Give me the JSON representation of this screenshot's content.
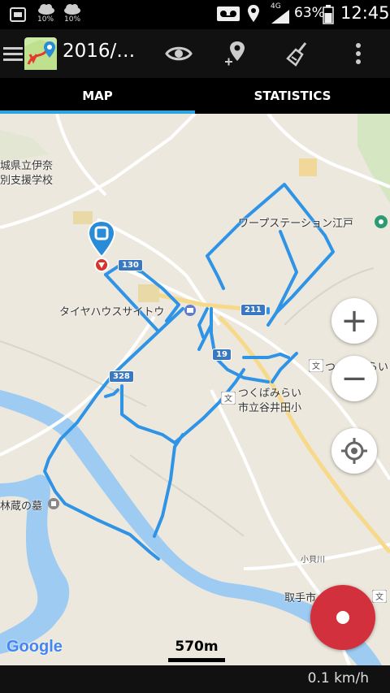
{
  "status_bar": {
    "weather_1_pct": "10%",
    "weather_2_pct": "10%",
    "network": "4G",
    "battery": "63%",
    "time": "12:45"
  },
  "app_bar": {
    "title": "2016/…",
    "actions": [
      "eye-icon",
      "add-location-icon",
      "broom-icon",
      "overflow-menu-icon"
    ]
  },
  "tabs": [
    {
      "label": "MAP",
      "active": true
    },
    {
      "label": "STATISTICS",
      "active": false
    }
  ],
  "map": {
    "labels": {
      "school_line1": "城県立伊奈",
      "school_line2": "別支援学校",
      "warp_station": "ワープステーション江戸",
      "tire_house": "タイヤハウスサイトウ",
      "tsukubamirai_partial": "つくばみらい",
      "school2_line1": "つくばみらい",
      "school2_line2": "市立谷井田小",
      "grave": "林蔵の墓",
      "river": "小貝川",
      "toride": "取手市"
    },
    "road_shields": [
      "130",
      "211",
      "19",
      "328"
    ],
    "scale": "570m",
    "attribution": "Google",
    "track_color": "#2f93e6",
    "river_color": "#9ecbf2"
  },
  "controls": {
    "zoom_in": "+",
    "zoom_out": "−"
  },
  "bottom_bar": {
    "speed": "0.1 km/h"
  }
}
